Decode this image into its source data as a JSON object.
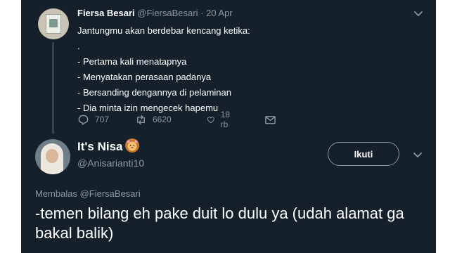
{
  "parent_tweet": {
    "author_name": "Fiersa Besari",
    "author_handle": "@FiersaBesari",
    "separator": "·",
    "date": "20 Apr",
    "lines": [
      "Jantungmu akan berdebar kencang ketika:",
      ".",
      "- Pertama kali menatapnya",
      "- Menyatakan perasaan padanya",
      "- Bersanding dengannya di pelaminan",
      "- Dia minta izin mengecek hapemu"
    ],
    "actions": {
      "reply_count": "707",
      "retweet_count": "6620",
      "like_count": "18 rb"
    }
  },
  "reply_tweet": {
    "author_name": "It's Nisa",
    "author_emoji": "lion-face-emoji",
    "author_handle": "@Anisarianti10",
    "follow_label": "Ikuti",
    "replying_to": "Membalas @FiersaBesari",
    "text": "-temen bilang eh pake duit lo dulu ya (udah alamat ga bakal balik)"
  },
  "colors": {
    "background": "#15202b",
    "text": "#ffffff",
    "muted": "#8899a6",
    "thread_line": "#38444d",
    "retweet_icon": "#8899a6"
  }
}
